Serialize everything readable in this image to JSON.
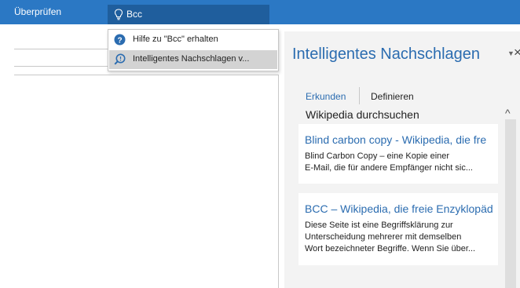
{
  "ribbon": {
    "active_tab": "Überprüfen",
    "search_value": "Bcc"
  },
  "search_dropdown": {
    "items": [
      {
        "label": "Hilfe zu \"Bcc\" erhalten",
        "icon": "help-icon"
      },
      {
        "label": "Intelligentes Nachschlagen v...",
        "icon": "smart-lookup-icon"
      }
    ]
  },
  "pane": {
    "title": "Intelligentes Nachschlagen",
    "tabs": [
      "Erkunden",
      "Definieren"
    ],
    "section_title": "Wikipedia durchsuchen",
    "results": [
      {
        "title": "Blind carbon copy - Wikipedia, die fre",
        "lines": [
          "Blind Carbon Copy – eine Kopie einer",
          "E-Mail, die für andere Empfänger nicht sic..."
        ]
      },
      {
        "title": "BCC – Wikipedia, die freie Enzyklopäd",
        "lines": [
          "Diese Seite ist eine Begriffsklärung zur",
          "Unterscheidung mehrerer mit demselben",
          "Wort bezeichneter Begriffe. Wenn Sie über..."
        ]
      }
    ]
  },
  "colors": {
    "ribbon": "#2b78c4",
    "search_box": "#1f5e9d",
    "accent_text": "#2b6cb0",
    "pane_bg": "#f3f3f3"
  }
}
